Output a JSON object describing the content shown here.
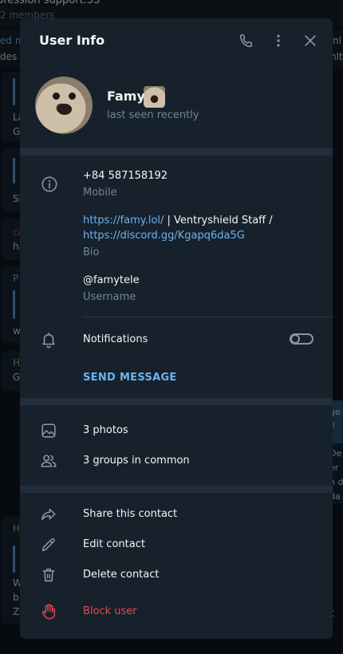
{
  "background": {
    "chat_title": "pression support.33",
    "chat_members": "2 members",
    "strip_left_top": "ed m",
    "strip_left_bottom": "des T",
    "strip_right_top": "nl",
    "strip_right_bottom": "nlt",
    "bubble_snippets": [
      "La",
      "G",
      "Si",
      "ca",
      "ha",
      "P",
      "w",
      "H",
      "G",
      "H",
      "W",
      "b",
      "Zu"
    ],
    "right_snippets": [
      "ge",
      "e",
      "De",
      "er",
      "n d",
      "da",
      "k"
    ]
  },
  "dialog": {
    "title": "User Info",
    "header_icons": [
      "phone-icon",
      "more-vert-icon",
      "close-icon"
    ]
  },
  "profile": {
    "name": "Famy",
    "status": "last seen recently"
  },
  "info": {
    "phone": "+84 587158192",
    "phone_label": "Mobile",
    "bio_link1": "https://famy.lol/",
    "bio_text": " | Ventryshield Staff /",
    "bio_link2": "https://discord.gg/Kgapq6da5G",
    "bio_label": "Bio",
    "username": "@famytele",
    "username_label": "Username"
  },
  "notifications": {
    "label": "Notifications",
    "enabled": false
  },
  "send_message": "SEND MESSAGE",
  "media": {
    "photos": "3 photos",
    "groups": "3 groups in common"
  },
  "actions": {
    "share": "Share this contact",
    "edit": "Edit contact",
    "delete": "Delete contact",
    "block": "Block user"
  },
  "colors": {
    "accent": "#6ab3f3",
    "danger": "#e5494d",
    "panel": "#17212b",
    "muted": "#708499"
  }
}
